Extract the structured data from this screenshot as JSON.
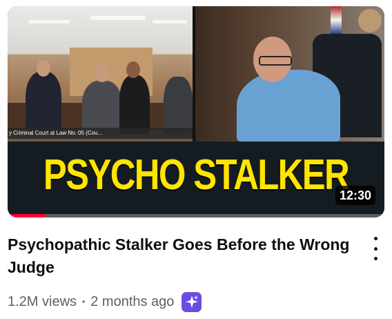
{
  "video": {
    "thumbnail": {
      "caption": "y Criminal Court at Law No. 05 (Cou...",
      "headline": "PSYCHO STALKER",
      "duration": "12:30",
      "watched_fraction": 0.1
    },
    "title": "Psychopathic Stalker Goes Before the Wrong Judge",
    "views": "1.2M views",
    "age": "2 months ago",
    "menu_icon": "vertical-ellipsis-icon",
    "badge_icon": "sparkle-icon",
    "colors": {
      "headline": "#ffe500",
      "progress": "#ff0033",
      "badge": "#6c4ce0"
    }
  }
}
